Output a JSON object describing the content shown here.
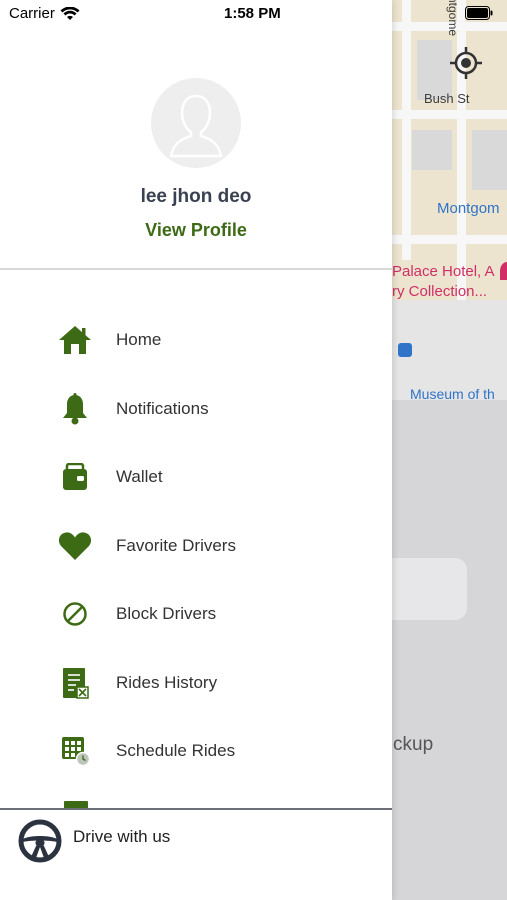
{
  "status_bar": {
    "carrier": "Carrier",
    "time": "1:58 PM"
  },
  "profile": {
    "name": "lee jhon deo",
    "view_profile": "View Profile"
  },
  "menu": {
    "items": [
      {
        "label": "Home",
        "icon": "home-icon"
      },
      {
        "label": "Notifications",
        "icon": "bell-icon"
      },
      {
        "label": "Wallet",
        "icon": "wallet-icon"
      },
      {
        "label": "Favorite Drivers",
        "icon": "heart-icon"
      },
      {
        "label": "Block Drivers",
        "icon": "block-icon"
      },
      {
        "label": "Rides History",
        "icon": "history-icon"
      },
      {
        "label": "Schedule Rides",
        "icon": "schedule-icon"
      }
    ]
  },
  "bottom": {
    "drive_label": "Drive with us"
  },
  "map": {
    "labels": {
      "bush": "Bush St",
      "montgomery": "Montgom",
      "palace_1": "Palace Hotel, A",
      "palace_2": "ry Collection...",
      "museum": "Museum of th",
      "vertical_street": "ntgome"
    }
  },
  "background": {
    "pickup_fragment": "ckup"
  },
  "colors": {
    "accent": "#3d6a15",
    "name_text": "#3a4150",
    "map_blue": "#2f74c8",
    "map_pink": "#d02f66"
  }
}
